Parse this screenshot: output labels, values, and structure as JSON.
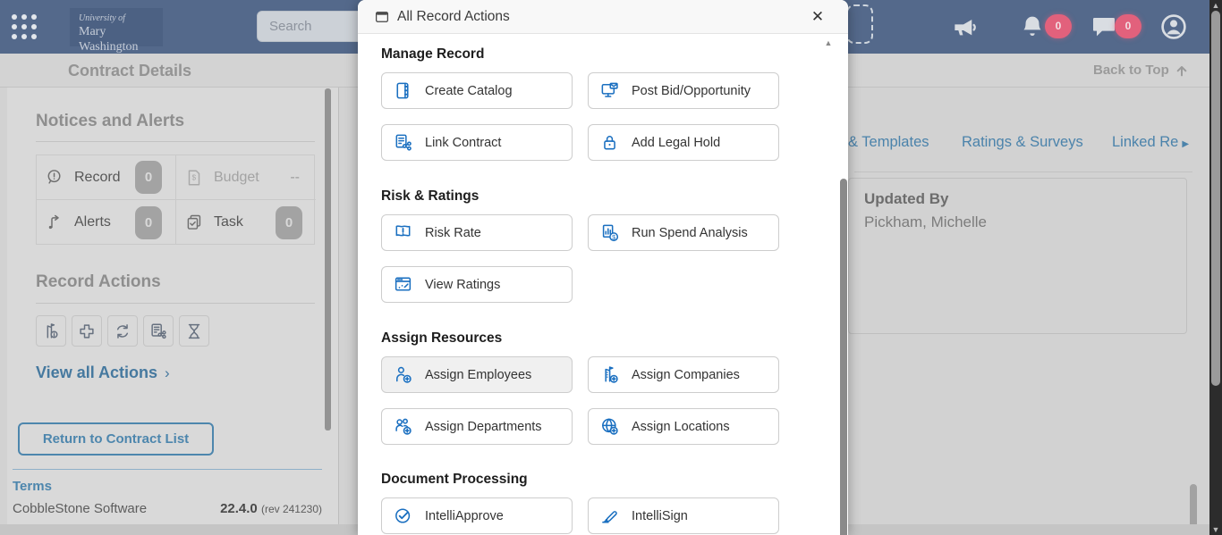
{
  "topbar": {
    "logo_line1": "University of",
    "logo_line2": "Mary Washington",
    "search_placeholder": "Search",
    "notification_count": "0",
    "message_count": "0"
  },
  "subbar": {
    "title": "Contract Details",
    "back_to_top": "Back to Top"
  },
  "sidebar": {
    "notices": {
      "title": "Notices and Alerts",
      "items": [
        {
          "label": "Record",
          "value": "0",
          "icon": "record-alert"
        },
        {
          "label": "Budget",
          "value": "--",
          "icon": "budget-doc"
        },
        {
          "label": "Alerts",
          "value": "0",
          "icon": "alerts-arrow"
        },
        {
          "label": "Task",
          "value": "0",
          "icon": "task-check"
        }
      ]
    },
    "record_actions": {
      "title": "Record Actions",
      "icons": [
        "entity-info",
        "add",
        "renew",
        "document-share",
        "history"
      ],
      "view_all": "View all Actions",
      "chevron": "›"
    },
    "return_button": "Return to Contract List",
    "terms": "Terms",
    "brand": "CobbleStone Software",
    "version": "22.4.0",
    "revision": "(rev 241230)"
  },
  "content": {
    "tabs": [
      {
        "label": "& Templates"
      },
      {
        "label": "Ratings & Surveys"
      },
      {
        "label": "Linked Re",
        "overflow_arrow": "▶"
      }
    ],
    "updated_by_label": "Updated By",
    "updated_by_value": "Pickham, Michelle"
  },
  "modal": {
    "title": "All Record Actions",
    "close": "✕",
    "sections": [
      {
        "title": "Manage Record",
        "buttons": [
          {
            "label": "Create Catalog",
            "icon": "create-catalog"
          },
          {
            "label": "Post Bid/Opportunity",
            "icon": "post-bid"
          },
          {
            "label": "Link Contract",
            "icon": "link-contract"
          },
          {
            "label": "Add Legal Hold",
            "icon": "legal-hold"
          }
        ]
      },
      {
        "title": "Risk & Ratings",
        "buttons": [
          {
            "label": "Risk Rate",
            "icon": "risk-rate"
          },
          {
            "label": "Run Spend Analysis",
            "icon": "spend-analysis"
          },
          {
            "label": "View Ratings",
            "icon": "view-ratings"
          }
        ]
      },
      {
        "title": "Assign Resources",
        "buttons": [
          {
            "label": "Assign Employees",
            "icon": "assign-employees"
          },
          {
            "label": "Assign Companies",
            "icon": "assign-companies"
          },
          {
            "label": "Assign Departments",
            "icon": "assign-departments"
          },
          {
            "label": "Assign Locations",
            "icon": "assign-locations"
          }
        ]
      },
      {
        "title": "Document Processing",
        "buttons": [
          {
            "label": "IntelliApprove",
            "icon": "intelliapprove"
          },
          {
            "label": "IntelliSign",
            "icon": "intellisign"
          }
        ]
      }
    ]
  },
  "colors": {
    "accent_blue": "#1a6fc0",
    "badge_pink": "#e2617c",
    "link_blue": "#4b83ab",
    "topbar_blue": "#54698b"
  }
}
